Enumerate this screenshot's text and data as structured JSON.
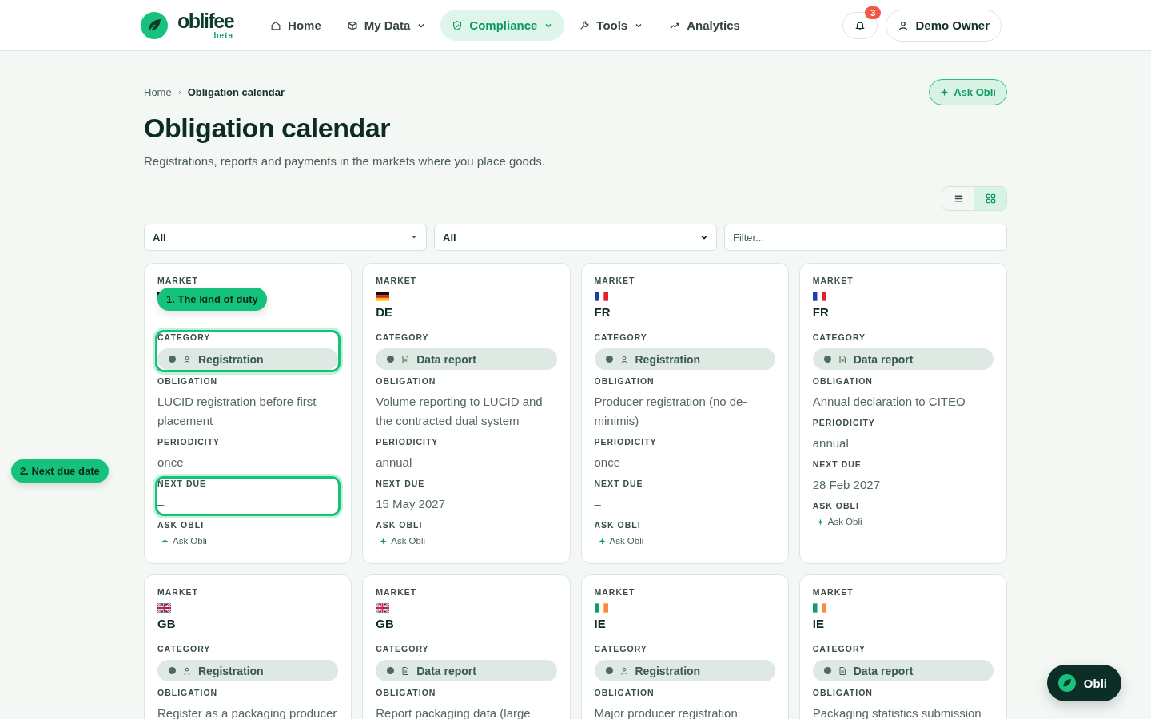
{
  "brand": {
    "name": "oblifee",
    "tag": "beta"
  },
  "nav": [
    {
      "label": "Home",
      "kind": "home",
      "dropdown": false,
      "selected": false
    },
    {
      "label": "My Data",
      "kind": "data",
      "dropdown": true,
      "selected": false
    },
    {
      "label": "Compliance",
      "kind": "compliance",
      "dropdown": true,
      "selected": true
    },
    {
      "label": "Tools",
      "kind": "tools",
      "dropdown": true,
      "selected": false
    },
    {
      "label": "Analytics",
      "kind": "analytics",
      "dropdown": false,
      "selected": false
    }
  ],
  "notifications": {
    "count": "3"
  },
  "user": {
    "name": "Demo Owner"
  },
  "breadcrumb": [
    "Home",
    "Obligation calendar"
  ],
  "ask_button": "Ask Obli",
  "title": "Obligation calendar",
  "subtitle": "Registrations, reports and payments in the markets where you place goods.",
  "views": [
    {
      "kind": "list",
      "selected": false
    },
    {
      "kind": "grid",
      "selected": true
    }
  ],
  "filters": [
    {
      "kind": "select",
      "value": "All"
    },
    {
      "kind": "native",
      "value": "All"
    },
    {
      "kind": "text",
      "placeholder": "Filter..."
    }
  ],
  "cards": [
    {
      "market": {
        "label": "MARKET",
        "kind": "de"
      },
      "category": {
        "label": "CATEGORY",
        "kind": "registration",
        "value": "Registration",
        "highlighted": true
      },
      "details": [
        {
          "label": "OBLIGATION",
          "value": "LUCID registration before first placement",
          "highlighted": false
        },
        {
          "label": "PERIODICITY",
          "value": "once",
          "highlighted": false
        },
        {
          "label": "NEXT DUE",
          "value": "–",
          "highlighted": true
        }
      ],
      "ask": {
        "label": "ASK OBLI",
        "link": "Ask Obli"
      }
    },
    {
      "market": {
        "label": "MARKET",
        "kind": "de",
        "value": "DE"
      },
      "category": {
        "label": "CATEGORY",
        "kind": "report",
        "value": "Data report",
        "highlighted": false
      },
      "details": [
        {
          "label": "OBLIGATION",
          "value": "Volume reporting to LUCID and the contracted dual system",
          "highlighted": false
        },
        {
          "label": "PERIODICITY",
          "value": "annual",
          "highlighted": false
        },
        {
          "label": "NEXT DUE",
          "value": "15 May 2027",
          "highlighted": false
        }
      ],
      "ask": {
        "label": "ASK OBLI",
        "link": "Ask Obli"
      }
    },
    {
      "market": {
        "label": "MARKET",
        "kind": "fr",
        "value": "FR"
      },
      "category": {
        "label": "CATEGORY",
        "kind": "registration",
        "value": "Registration",
        "highlighted": false
      },
      "details": [
        {
          "label": "OBLIGATION",
          "value": "Producer registration (no de-minimis)",
          "highlighted": false
        },
        {
          "label": "PERIODICITY",
          "value": "once",
          "highlighted": false
        },
        {
          "label": "NEXT DUE",
          "value": "–",
          "highlighted": false
        }
      ],
      "ask": {
        "label": "ASK OBLI",
        "link": "Ask Obli"
      }
    },
    {
      "market": {
        "label": "MARKET",
        "kind": "fr",
        "value": "FR"
      },
      "category": {
        "label": "CATEGORY",
        "kind": "report",
        "value": "Data report",
        "highlighted": false
      },
      "details": [
        {
          "label": "OBLIGATION",
          "value": "Annual declaration to CITEO",
          "highlighted": false
        },
        {
          "label": "PERIODICITY",
          "value": "annual",
          "highlighted": false
        },
        {
          "label": "NEXT DUE",
          "value": "28 Feb 2027",
          "highlighted": false
        }
      ],
      "ask": {
        "label": "ASK OBLI",
        "link": "Ask Obli"
      }
    },
    {
      "market": {
        "label": "MARKET",
        "kind": "gb",
        "value": "GB"
      },
      "category": {
        "label": "CATEGORY",
        "kind": "registration",
        "value": "Registration",
        "highlighted": false
      },
      "details": [
        {
          "label": "OBLIGATION",
          "value": "Register as a packaging producer",
          "highlighted": false
        }
      ]
    },
    {
      "market": {
        "label": "MARKET",
        "kind": "gb",
        "value": "GB"
      },
      "category": {
        "label": "CATEGORY",
        "kind": "report",
        "value": "Data report",
        "highlighted": false
      },
      "details": [
        {
          "label": "OBLIGATION",
          "value": "Report packaging data (large",
          "highlighted": false
        }
      ]
    },
    {
      "market": {
        "label": "MARKET",
        "kind": "ie",
        "value": "IE"
      },
      "category": {
        "label": "CATEGORY",
        "kind": "registration",
        "value": "Registration",
        "highlighted": false
      },
      "details": [
        {
          "label": "OBLIGATION",
          "value": "Major producer registration",
          "highlighted": false
        }
      ]
    },
    {
      "market": {
        "label": "MARKET",
        "kind": "ie",
        "value": "IE"
      },
      "category": {
        "label": "CATEGORY",
        "kind": "report",
        "value": "Data report",
        "highlighted": false
      },
      "details": [
        {
          "label": "OBLIGATION",
          "value": "Packaging statistics submission",
          "highlighted": false
        }
      ]
    }
  ],
  "tour": [
    {
      "label": "1. The kind of duty"
    },
    {
      "label": "2. Next due date"
    }
  ],
  "assistant": {
    "label": "Obli"
  }
}
